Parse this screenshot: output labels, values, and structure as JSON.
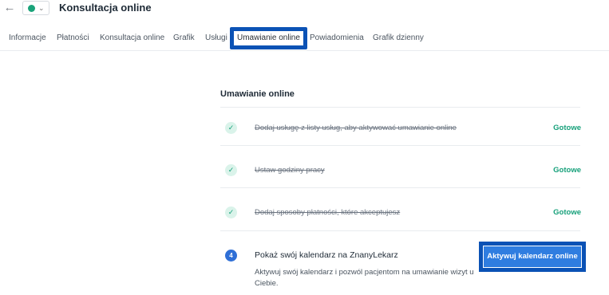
{
  "header": {
    "back_icon": "arrow-left-icon",
    "status_color": "#1aa37a",
    "title": "Konsultacja online"
  },
  "tabs": [
    {
      "label": "Informacje"
    },
    {
      "label": "Płatności"
    },
    {
      "label": "Konsultacja online"
    },
    {
      "label": "Grafik"
    },
    {
      "label": "Usługi"
    },
    {
      "label": "Umawianie online",
      "active": true
    },
    {
      "label": "Powiadomienia"
    },
    {
      "label": "Grafik dzienny"
    }
  ],
  "section": {
    "title": "Umawianie online",
    "steps": [
      {
        "text": "Dodaj usługę z listy usług, aby aktywować umawianie online",
        "status": "Gotowe"
      },
      {
        "text": "Ustaw godziny pracy",
        "status": "Gotowe"
      },
      {
        "text": "Dodaj sposoby płatności, które akceptujesz",
        "status": "Gotowe"
      }
    ],
    "step4": {
      "number": "4",
      "title": "Pokaż swój kalendarz na ZnanyLekarz",
      "description": "Aktywuj swój kalendarz i pozwól pacjentom na umawianie wizyt u Ciebie.",
      "button_label": "Aktywuj kalendarz online"
    }
  },
  "colors": {
    "accent": "#2f7de0",
    "highlight_border": "#0b52b5",
    "done": "#16a07a"
  }
}
